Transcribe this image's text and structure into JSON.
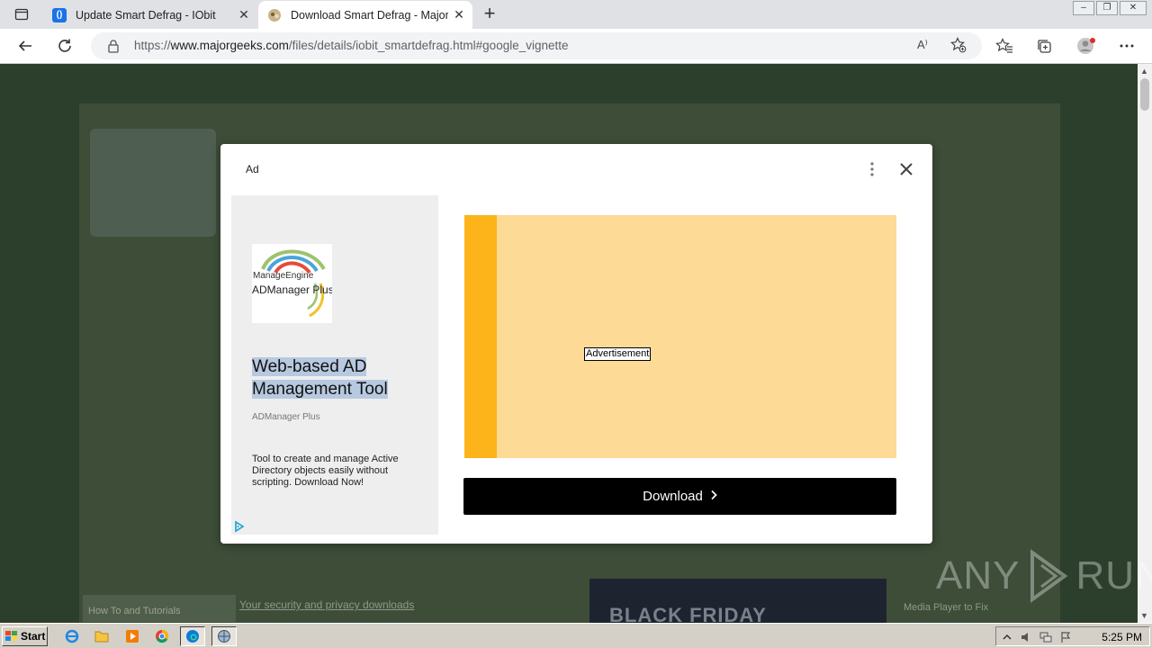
{
  "browser": {
    "tabs": [
      {
        "title": "Update Smart Defrag - IObit",
        "active": false
      },
      {
        "title": "Download Smart Defrag - MajorGeeks",
        "active": true
      }
    ],
    "url_prefix": "https://",
    "url_domain": "www.majorgeeks.com",
    "url_path": "/files/details/iobit_smartdefrag.html#google_vignette",
    "read_aloud_label": "A⁾"
  },
  "ad_modal": {
    "ad_label": "Ad",
    "logo_brand": "ManageEngine",
    "logo_product": "ADManager Plus",
    "headline_line1": "Web-based AD",
    "headline_line2": "Management Tool",
    "advertiser": "ADManager Plus",
    "description": "Tool to create and manage Active Directory objects easily without scripting. Download Now!",
    "creative_label": "Advertisement",
    "download_label": "Download",
    "download_chevron": "›"
  },
  "background_page": {
    "banner_text": "BLACK FRIDAY",
    "link1": "How To and Tutorials",
    "link2": "Your security and privacy downloads",
    "link3": "Media Player to Fix"
  },
  "watermark": {
    "left": "ANY",
    "right": "RUN"
  },
  "taskbar": {
    "start_label": "Start",
    "clock": "5:25 PM"
  },
  "colors": {
    "creative_bg": "#fdda96",
    "creative_stripe": "#fdb31a",
    "download_bg": "#000000",
    "headline_highlight": "#b7c9e0"
  }
}
